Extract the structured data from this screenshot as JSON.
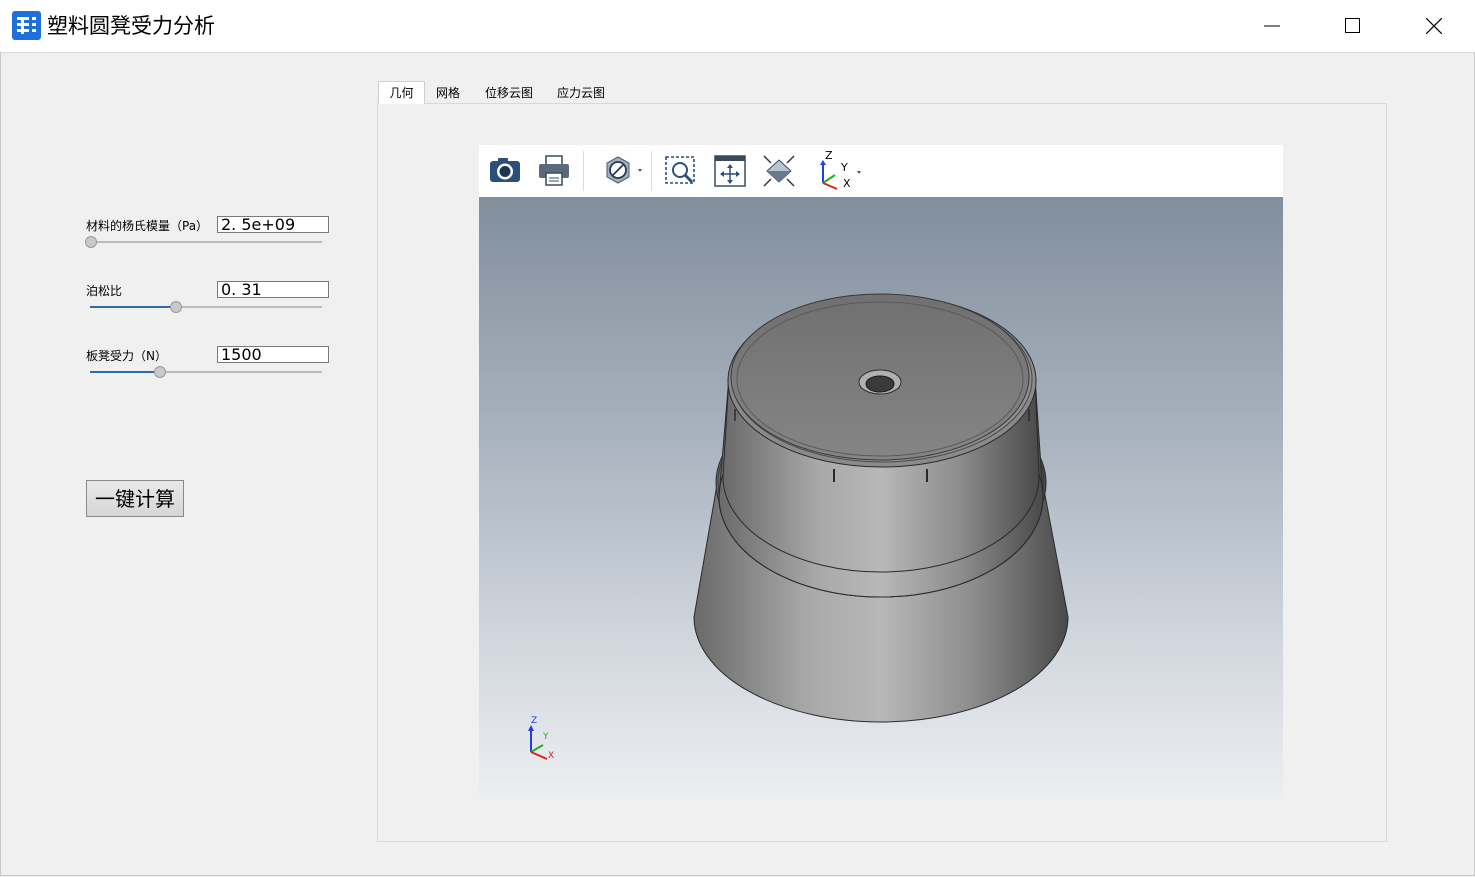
{
  "app": {
    "title": "塑料圆凳受力分析",
    "icon": "app-logo-icon"
  },
  "window_controls": [
    "minimize-icon",
    "maximize-icon",
    "close-icon"
  ],
  "params": [
    {
      "label": "材料的杨氏模量（Pa）",
      "value": "2. 5e+09",
      "slider_fraction": 0.0
    },
    {
      "label": "泊松比",
      "value": "0. 31",
      "slider_fraction": 0.37
    },
    {
      "label": "板凳受力（N）",
      "value": "1500",
      "slider_fraction": 0.3
    }
  ],
  "calc_button": {
    "label": "一键计算"
  },
  "tabs": [
    {
      "label": "几何",
      "active": true
    },
    {
      "label": "网格",
      "active": false
    },
    {
      "label": "位移云图",
      "active": false
    },
    {
      "label": "应力云图",
      "active": false
    }
  ],
  "viewer_toolbar": {
    "tools": [
      "camera-icon",
      "print-icon",
      "display-mode-icon",
      "zoom-box-icon",
      "pan-icon",
      "fit-all-icon",
      "axis-view-icon"
    ],
    "axis_labels": {
      "x": "X",
      "y": "Y",
      "z": "Z"
    }
  },
  "triad": {
    "x": "X",
    "y": "Y",
    "z": "Z"
  },
  "colors": {
    "accent": "#2b6cb0",
    "app_icon": "#1e6fd9",
    "viewport_top": "#818e9c",
    "viewport_bottom": "#eceef1",
    "axis_x": "#e02020",
    "axis_y": "#20b020",
    "axis_z": "#2040e0"
  }
}
